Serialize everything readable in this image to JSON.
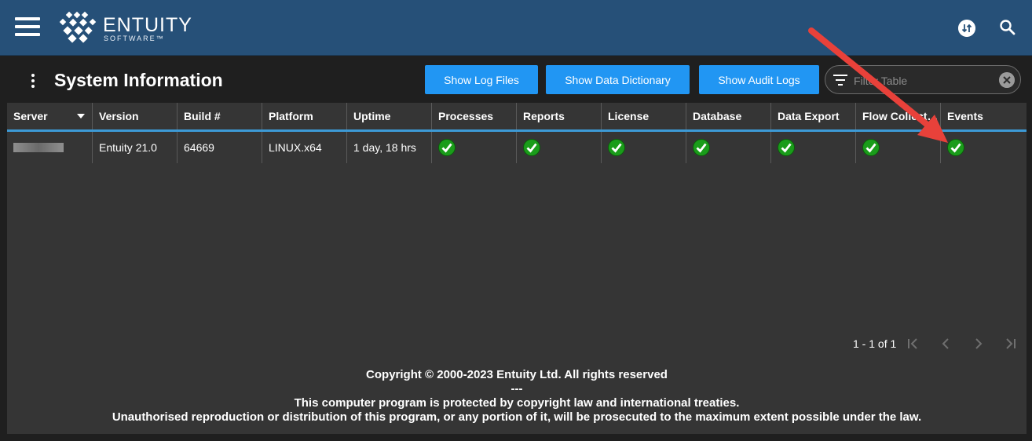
{
  "app": {
    "brand_name": "ENTUITY",
    "brand_sub": "SOFTWARE™"
  },
  "header": {
    "title": "System Information",
    "buttons": {
      "log_files": "Show Log Files",
      "data_dictionary": "Show Data Dictionary",
      "audit_logs": "Show Audit Logs"
    },
    "filter_placeholder": "Filter Table"
  },
  "table": {
    "columns": [
      "Server",
      "Version",
      "Build #",
      "Platform",
      "Uptime",
      "Processes",
      "Reports",
      "License",
      "Database",
      "Data Export",
      "Flow Collect…",
      "Events"
    ],
    "rows": [
      {
        "server": "",
        "version": "Entuity 21.0",
        "build": "64669",
        "platform": "LINUX.x64",
        "uptime": "1 day, 18 hrs",
        "statuses": [
          "ok",
          "ok",
          "ok",
          "ok",
          "ok",
          "ok",
          "ok"
        ]
      }
    ]
  },
  "pagination": {
    "range": "1 - 1 of 1"
  },
  "footer": {
    "line1": "Copyright © 2000-2023 Entuity Ltd. All rights reserved",
    "line2": "---",
    "line3": "This computer program is protected by copyright law and international treaties.",
    "line4": "Unauthorised reproduction or distribution of this program, or any portion of it, will be prosecuted to the maximum extent possible under the law."
  },
  "colors": {
    "appbar": "#265078",
    "button": "#2196f3",
    "panel": "#353535",
    "status_ok": "#1a9c1a",
    "annotation_arrow": "#e8413a"
  }
}
